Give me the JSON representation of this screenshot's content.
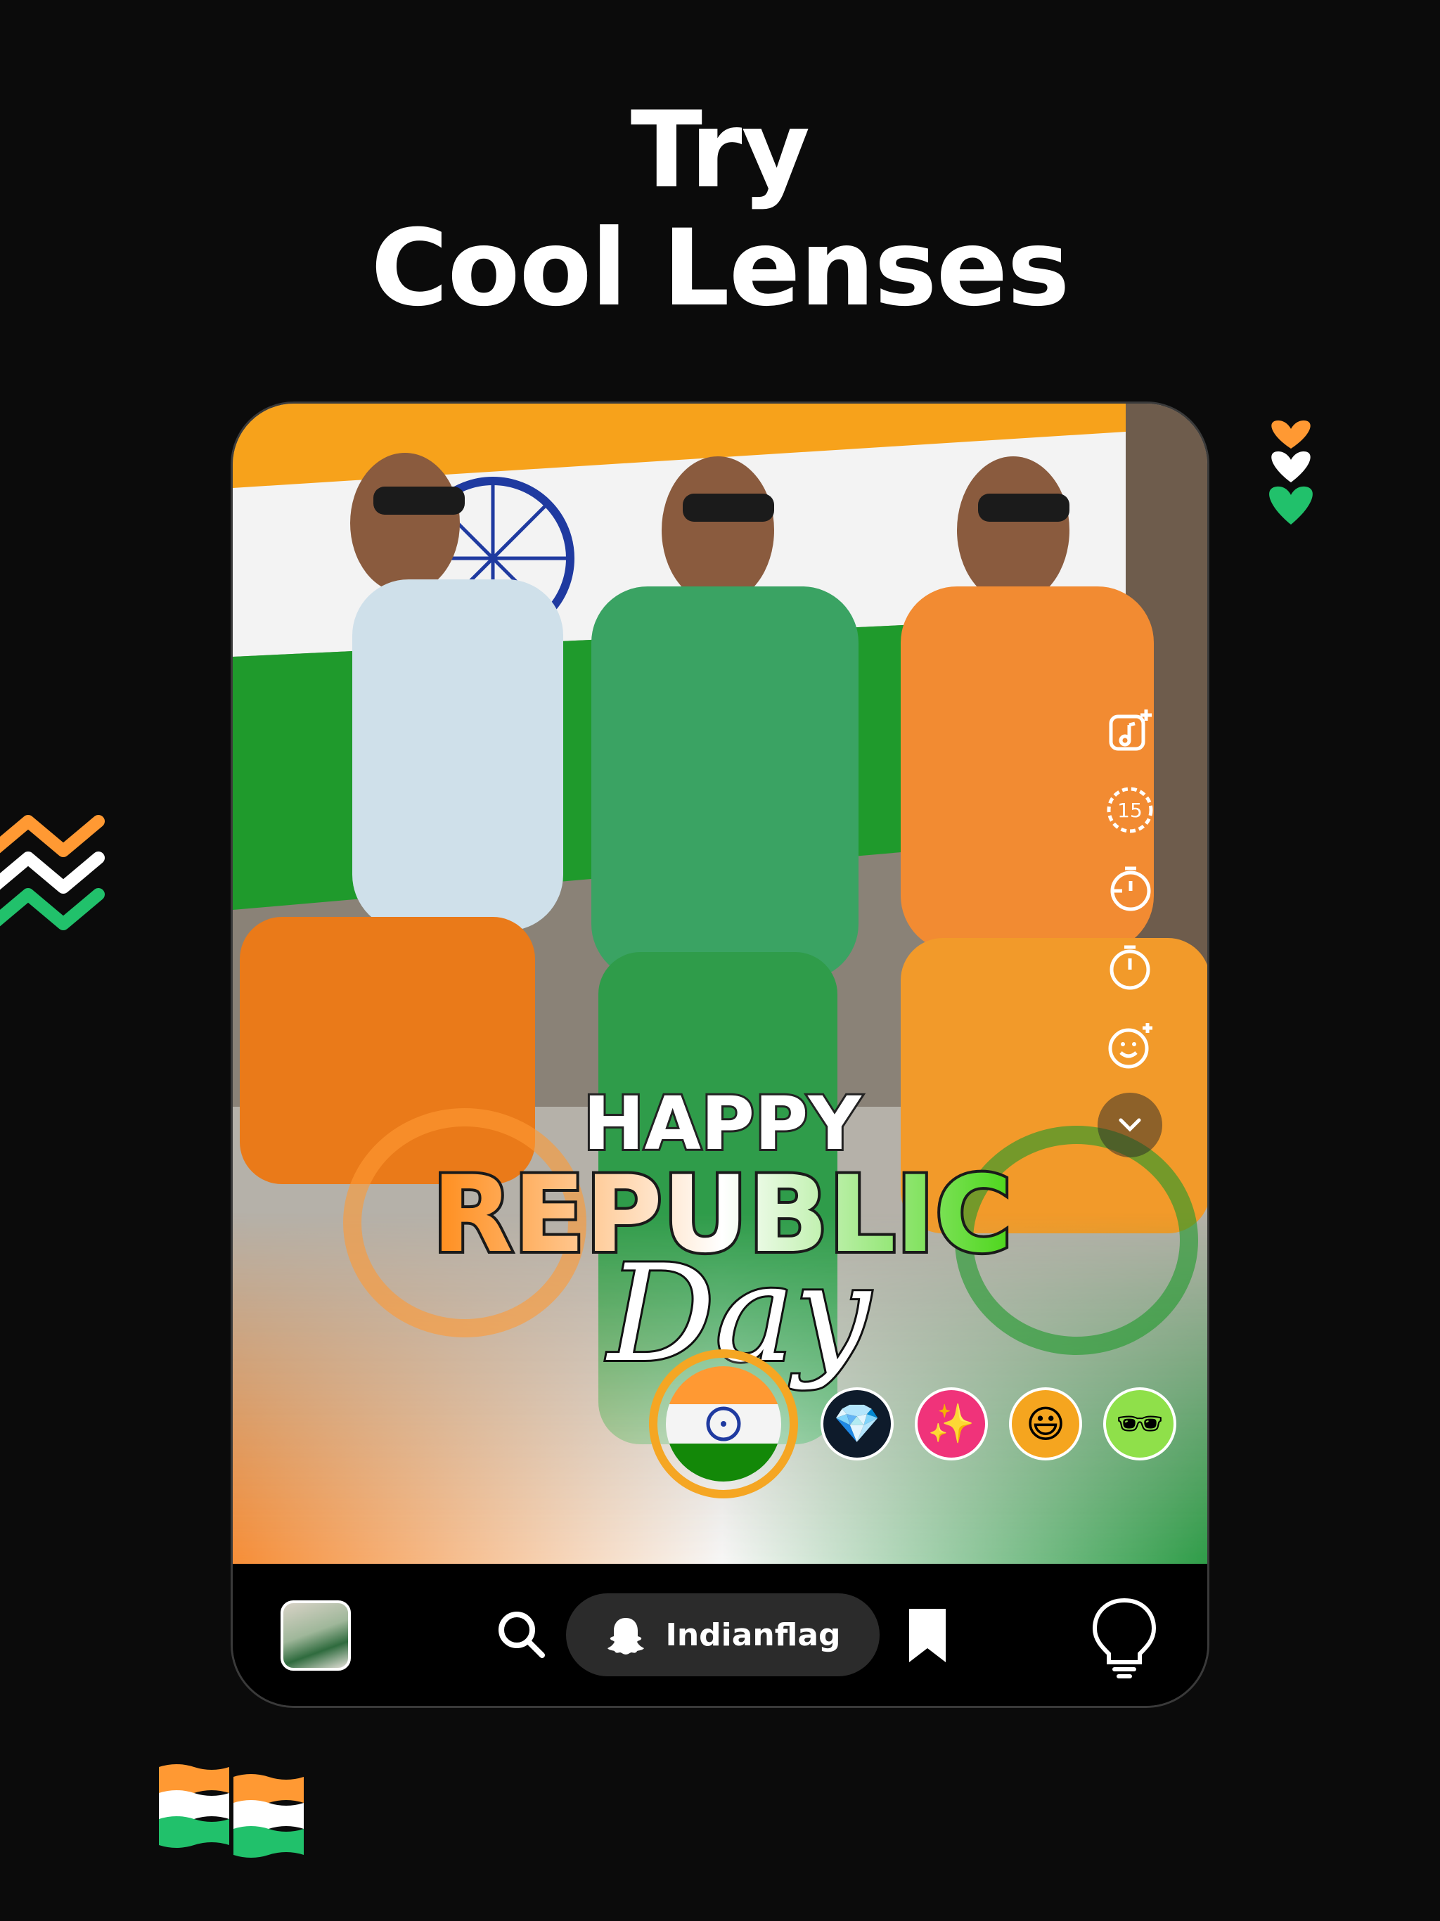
{
  "headline": {
    "line1": "Try",
    "line2": "Cool Lenses"
  },
  "lens_overlay": {
    "happy": "HAPPY",
    "republic": "REPUBLIC",
    "day": "Day"
  },
  "right_rail": [
    {
      "icon": "music-add-icon"
    },
    {
      "icon": "timer-15-icon",
      "label": "15"
    },
    {
      "icon": "countdown-timer-icon"
    },
    {
      "icon": "stopwatch-icon"
    },
    {
      "icon": "face-add-icon"
    },
    {
      "icon": "chevron-down-icon"
    }
  ],
  "lenses": [
    {
      "icon": "indian-flag-lens-icon",
      "selected": true
    },
    {
      "icon": "earrings-lens-icon",
      "glyph": "💎"
    },
    {
      "icon": "sparkles-lens-icon",
      "glyph": "✨"
    },
    {
      "icon": "cartoon-face-lens-icon",
      "glyph": "😃"
    },
    {
      "icon": "3d-glasses-lens-icon",
      "glyph": "🕶"
    }
  ],
  "bottom_bar": {
    "search_icon": "search-icon",
    "lens_name": "Indianflag",
    "bookmark_icon": "bookmark-icon",
    "bulb_icon": "lightbulb-icon"
  },
  "colors": {
    "background": "#0b0b0b",
    "saffron": "#FF9933",
    "green": "#138808",
    "navy": "#1f3aa0",
    "selected_ring": "#f5a623"
  }
}
